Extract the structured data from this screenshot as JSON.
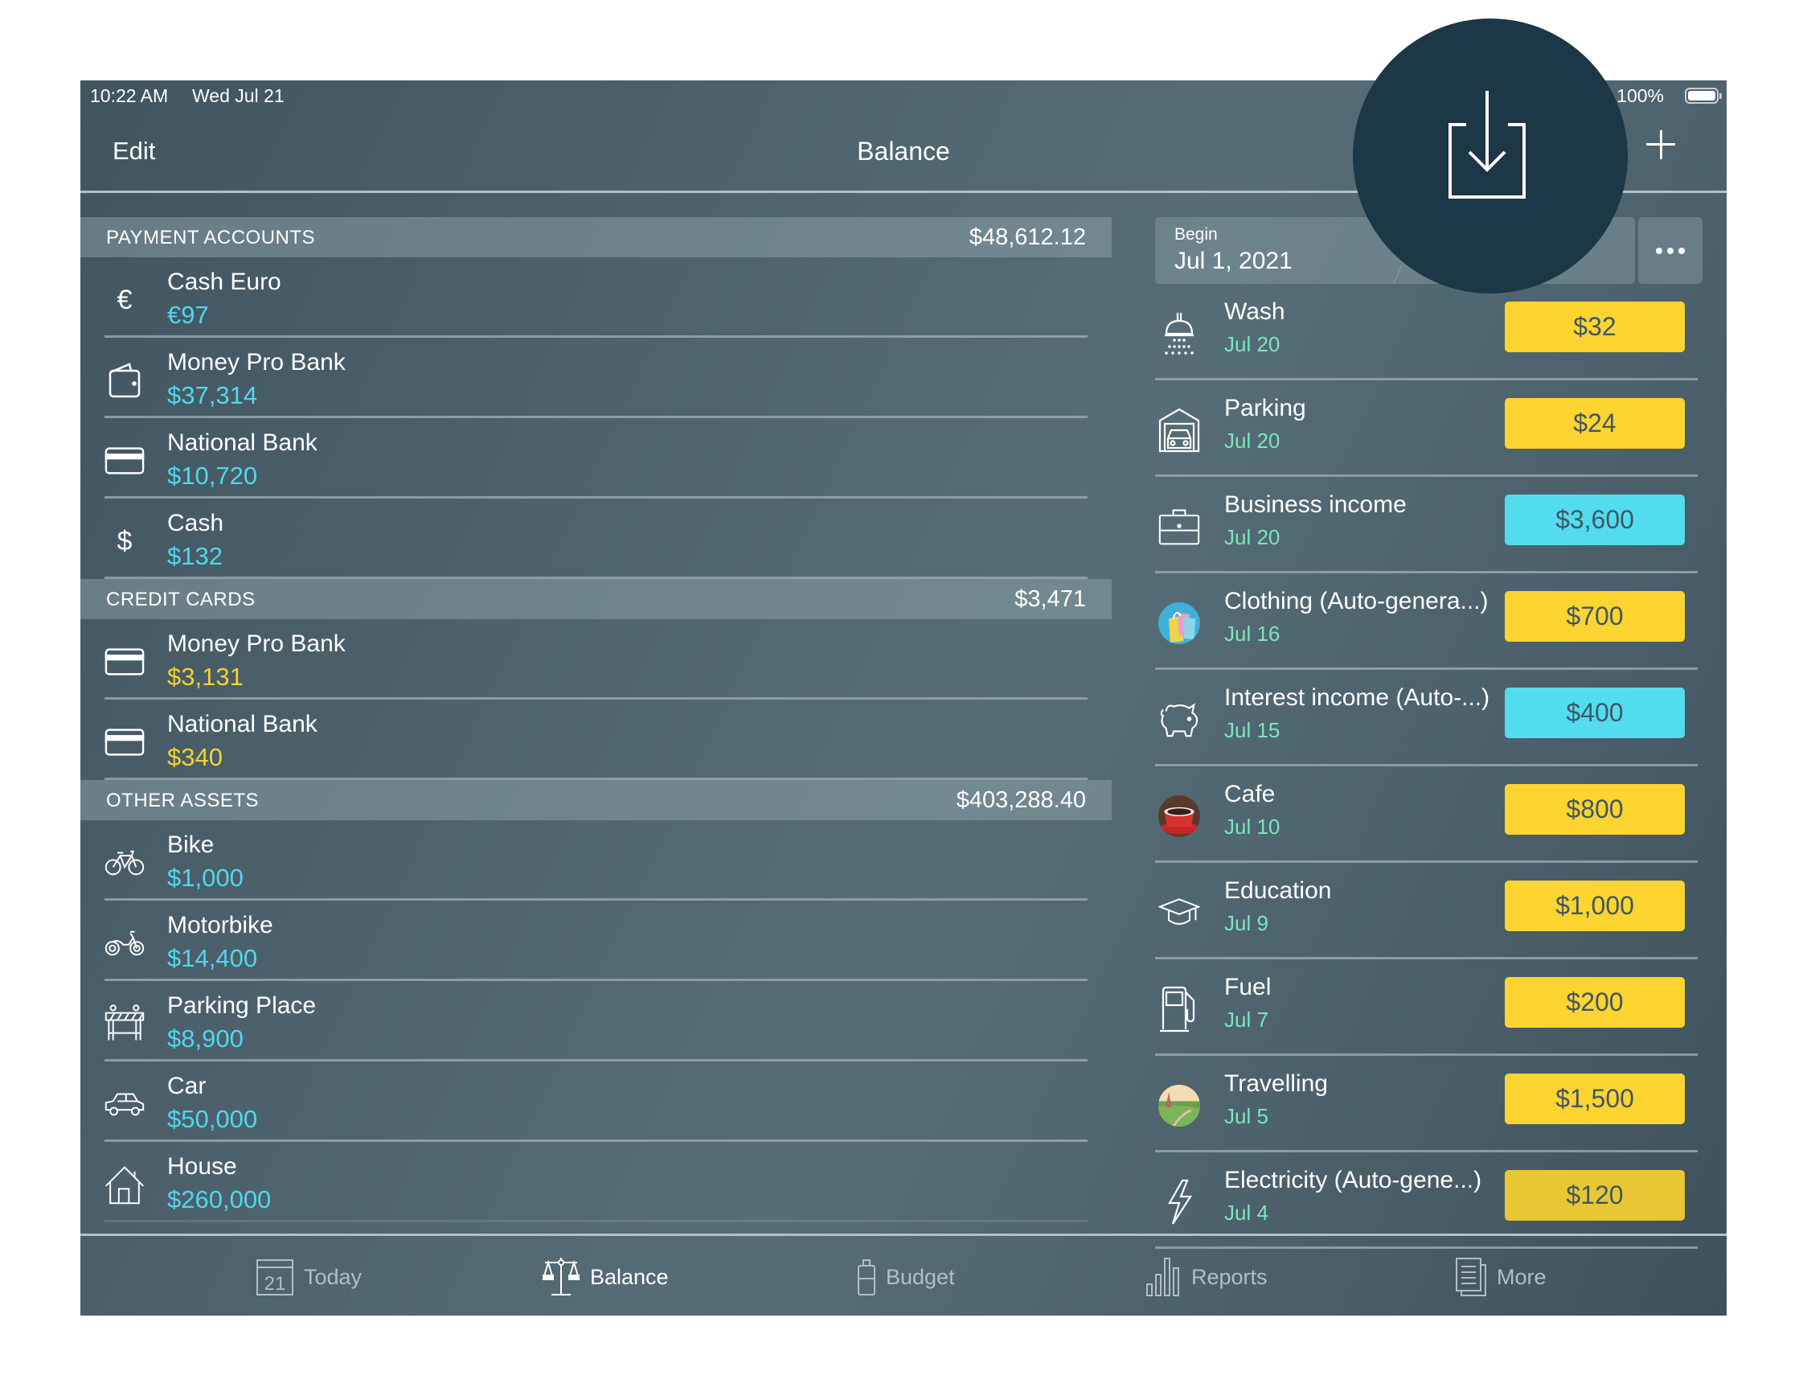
{
  "status_bar": {
    "time": "10:22 AM",
    "date": "Wed Jul 21",
    "battery": "100%"
  },
  "nav": {
    "edit_label": "Edit",
    "title": "Balance",
    "add_icon": "plus-icon",
    "import_icon": "import-download-icon"
  },
  "colors": {
    "asset_amount": "#4fd8ec",
    "liability_amount": "#f6d22e",
    "expense_badge": "#fdd430",
    "income_badge": "#52dcee",
    "date_text": "#7be6be",
    "spotlight": "#1c3745"
  },
  "accounts": {
    "sections": [
      {
        "title": "PAYMENT ACCOUNTS",
        "total": "$48,612.12",
        "items": [
          {
            "name": "Cash Euro",
            "amount": "€97",
            "icon": "euro-icon"
          },
          {
            "name": "Money Pro Bank",
            "amount": "$37,314",
            "icon": "wallet-icon"
          },
          {
            "name": "National Bank",
            "amount": "$10,720",
            "icon": "credit-card-icon"
          },
          {
            "name": "Cash",
            "amount": "$132",
            "icon": "dollar-icon"
          }
        ]
      },
      {
        "title": "CREDIT CARDS",
        "total": "$3,471",
        "items": [
          {
            "name": "Money Pro Bank",
            "amount": "$3,131",
            "icon": "credit-card-icon"
          },
          {
            "name": "National Bank",
            "amount": "$340",
            "icon": "credit-card-icon"
          }
        ]
      },
      {
        "title": "OTHER ASSETS",
        "total": "$403,288.40",
        "items": [
          {
            "name": "Bike",
            "amount": "$1,000",
            "icon": "bicycle-icon"
          },
          {
            "name": "Motorbike",
            "amount": "$14,400",
            "icon": "motorbike-icon"
          },
          {
            "name": "Parking Place",
            "amount": "$8,900",
            "icon": "barrier-icon"
          },
          {
            "name": "Car",
            "amount": "$50,000",
            "icon": "car-icon"
          },
          {
            "name": "House",
            "amount": "$260,000",
            "icon": "house-icon"
          }
        ]
      }
    ]
  },
  "period": {
    "label": "Begin",
    "value": "Jul 1, 2021",
    "more_icon": "ellipsis-icon"
  },
  "transactions": [
    {
      "name": "Wash",
      "date": "Jul 20",
      "amount": "$32",
      "type": "expense",
      "icon": "shower-icon"
    },
    {
      "name": "Parking",
      "date": "Jul 20",
      "amount": "$24",
      "type": "expense",
      "icon": "garage-icon"
    },
    {
      "name": "Business income",
      "date": "Jul 20",
      "amount": "$3,600",
      "type": "income",
      "icon": "briefcase-icon"
    },
    {
      "name": "Clothing (Auto-genera...)",
      "date": "Jul 16",
      "amount": "$700",
      "type": "expense",
      "icon": "shopping-bags-photo-icon"
    },
    {
      "name": "Interest income (Auto-...)",
      "date": "Jul 15",
      "amount": "$400",
      "type": "income",
      "icon": "piggy-bank-icon"
    },
    {
      "name": "Cafe",
      "date": "Jul 10",
      "amount": "$800",
      "type": "expense",
      "icon": "coffee-cup-photo-icon"
    },
    {
      "name": "Education",
      "date": "Jul 9",
      "amount": "$1,000",
      "type": "expense",
      "icon": "graduation-cap-icon"
    },
    {
      "name": "Fuel",
      "date": "Jul 7",
      "amount": "$200",
      "type": "expense",
      "icon": "fuel-pump-icon"
    },
    {
      "name": "Travelling",
      "date": "Jul 5",
      "amount": "$1,500",
      "type": "expense",
      "icon": "landscape-photo-icon"
    },
    {
      "name": "Electricity (Auto-gene...)",
      "date": "Jul 4",
      "amount": "$120",
      "type": "expense",
      "icon": "lightning-icon"
    }
  ],
  "tabbar": {
    "active": "Balance",
    "tabs": [
      {
        "label": "Today",
        "icon": "calendar-icon",
        "icon_text": "21"
      },
      {
        "label": "Balance",
        "icon": "scales-icon"
      },
      {
        "label": "Budget",
        "icon": "budget-jar-icon"
      },
      {
        "label": "Reports",
        "icon": "bar-chart-icon"
      },
      {
        "label": "More",
        "icon": "documents-icon"
      }
    ]
  }
}
